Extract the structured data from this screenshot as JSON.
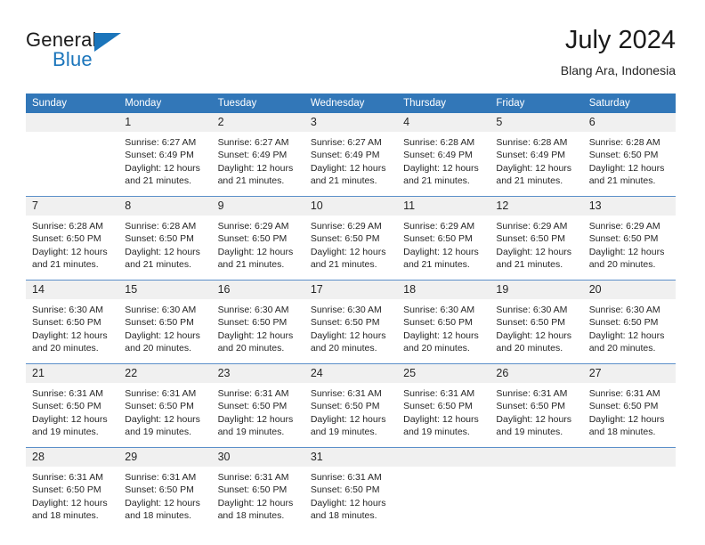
{
  "brand": {
    "name_part1": "General",
    "name_part2": "Blue",
    "logo_icon": "triangle-logo-icon"
  },
  "header": {
    "title": "July 2024",
    "location": "Blang Ara, Indonesia"
  },
  "colors": {
    "header_bar": "#3277b8",
    "brand_blue": "#1b75bb",
    "daynum_band": "#f0f0f0",
    "row_separator": "#5b8fc9",
    "text": "#262626"
  },
  "weekday_headers": [
    "Sunday",
    "Monday",
    "Tuesday",
    "Wednesday",
    "Thursday",
    "Friday",
    "Saturday"
  ],
  "weeks": [
    [
      {
        "day": "",
        "sunrise": "",
        "sunset": "",
        "daylight_line1": "",
        "daylight_line2": ""
      },
      {
        "day": "1",
        "sunrise": "Sunrise: 6:27 AM",
        "sunset": "Sunset: 6:49 PM",
        "daylight_line1": "Daylight: 12 hours",
        "daylight_line2": "and 21 minutes."
      },
      {
        "day": "2",
        "sunrise": "Sunrise: 6:27 AM",
        "sunset": "Sunset: 6:49 PM",
        "daylight_line1": "Daylight: 12 hours",
        "daylight_line2": "and 21 minutes."
      },
      {
        "day": "3",
        "sunrise": "Sunrise: 6:27 AM",
        "sunset": "Sunset: 6:49 PM",
        "daylight_line1": "Daylight: 12 hours",
        "daylight_line2": "and 21 minutes."
      },
      {
        "day": "4",
        "sunrise": "Sunrise: 6:28 AM",
        "sunset": "Sunset: 6:49 PM",
        "daylight_line1": "Daylight: 12 hours",
        "daylight_line2": "and 21 minutes."
      },
      {
        "day": "5",
        "sunrise": "Sunrise: 6:28 AM",
        "sunset": "Sunset: 6:49 PM",
        "daylight_line1": "Daylight: 12 hours",
        "daylight_line2": "and 21 minutes."
      },
      {
        "day": "6",
        "sunrise": "Sunrise: 6:28 AM",
        "sunset": "Sunset: 6:50 PM",
        "daylight_line1": "Daylight: 12 hours",
        "daylight_line2": "and 21 minutes."
      }
    ],
    [
      {
        "day": "7",
        "sunrise": "Sunrise: 6:28 AM",
        "sunset": "Sunset: 6:50 PM",
        "daylight_line1": "Daylight: 12 hours",
        "daylight_line2": "and 21 minutes."
      },
      {
        "day": "8",
        "sunrise": "Sunrise: 6:28 AM",
        "sunset": "Sunset: 6:50 PM",
        "daylight_line1": "Daylight: 12 hours",
        "daylight_line2": "and 21 minutes."
      },
      {
        "day": "9",
        "sunrise": "Sunrise: 6:29 AM",
        "sunset": "Sunset: 6:50 PM",
        "daylight_line1": "Daylight: 12 hours",
        "daylight_line2": "and 21 minutes."
      },
      {
        "day": "10",
        "sunrise": "Sunrise: 6:29 AM",
        "sunset": "Sunset: 6:50 PM",
        "daylight_line1": "Daylight: 12 hours",
        "daylight_line2": "and 21 minutes."
      },
      {
        "day": "11",
        "sunrise": "Sunrise: 6:29 AM",
        "sunset": "Sunset: 6:50 PM",
        "daylight_line1": "Daylight: 12 hours",
        "daylight_line2": "and 21 minutes."
      },
      {
        "day": "12",
        "sunrise": "Sunrise: 6:29 AM",
        "sunset": "Sunset: 6:50 PM",
        "daylight_line1": "Daylight: 12 hours",
        "daylight_line2": "and 21 minutes."
      },
      {
        "day": "13",
        "sunrise": "Sunrise: 6:29 AM",
        "sunset": "Sunset: 6:50 PM",
        "daylight_line1": "Daylight: 12 hours",
        "daylight_line2": "and 20 minutes."
      }
    ],
    [
      {
        "day": "14",
        "sunrise": "Sunrise: 6:30 AM",
        "sunset": "Sunset: 6:50 PM",
        "daylight_line1": "Daylight: 12 hours",
        "daylight_line2": "and 20 minutes."
      },
      {
        "day": "15",
        "sunrise": "Sunrise: 6:30 AM",
        "sunset": "Sunset: 6:50 PM",
        "daylight_line1": "Daylight: 12 hours",
        "daylight_line2": "and 20 minutes."
      },
      {
        "day": "16",
        "sunrise": "Sunrise: 6:30 AM",
        "sunset": "Sunset: 6:50 PM",
        "daylight_line1": "Daylight: 12 hours",
        "daylight_line2": "and 20 minutes."
      },
      {
        "day": "17",
        "sunrise": "Sunrise: 6:30 AM",
        "sunset": "Sunset: 6:50 PM",
        "daylight_line1": "Daylight: 12 hours",
        "daylight_line2": "and 20 minutes."
      },
      {
        "day": "18",
        "sunrise": "Sunrise: 6:30 AM",
        "sunset": "Sunset: 6:50 PM",
        "daylight_line1": "Daylight: 12 hours",
        "daylight_line2": "and 20 minutes."
      },
      {
        "day": "19",
        "sunrise": "Sunrise: 6:30 AM",
        "sunset": "Sunset: 6:50 PM",
        "daylight_line1": "Daylight: 12 hours",
        "daylight_line2": "and 20 minutes."
      },
      {
        "day": "20",
        "sunrise": "Sunrise: 6:30 AM",
        "sunset": "Sunset: 6:50 PM",
        "daylight_line1": "Daylight: 12 hours",
        "daylight_line2": "and 20 minutes."
      }
    ],
    [
      {
        "day": "21",
        "sunrise": "Sunrise: 6:31 AM",
        "sunset": "Sunset: 6:50 PM",
        "daylight_line1": "Daylight: 12 hours",
        "daylight_line2": "and 19 minutes."
      },
      {
        "day": "22",
        "sunrise": "Sunrise: 6:31 AM",
        "sunset": "Sunset: 6:50 PM",
        "daylight_line1": "Daylight: 12 hours",
        "daylight_line2": "and 19 minutes."
      },
      {
        "day": "23",
        "sunrise": "Sunrise: 6:31 AM",
        "sunset": "Sunset: 6:50 PM",
        "daylight_line1": "Daylight: 12 hours",
        "daylight_line2": "and 19 minutes."
      },
      {
        "day": "24",
        "sunrise": "Sunrise: 6:31 AM",
        "sunset": "Sunset: 6:50 PM",
        "daylight_line1": "Daylight: 12 hours",
        "daylight_line2": "and 19 minutes."
      },
      {
        "day": "25",
        "sunrise": "Sunrise: 6:31 AM",
        "sunset": "Sunset: 6:50 PM",
        "daylight_line1": "Daylight: 12 hours",
        "daylight_line2": "and 19 minutes."
      },
      {
        "day": "26",
        "sunrise": "Sunrise: 6:31 AM",
        "sunset": "Sunset: 6:50 PM",
        "daylight_line1": "Daylight: 12 hours",
        "daylight_line2": "and 19 minutes."
      },
      {
        "day": "27",
        "sunrise": "Sunrise: 6:31 AM",
        "sunset": "Sunset: 6:50 PM",
        "daylight_line1": "Daylight: 12 hours",
        "daylight_line2": "and 18 minutes."
      }
    ],
    [
      {
        "day": "28",
        "sunrise": "Sunrise: 6:31 AM",
        "sunset": "Sunset: 6:50 PM",
        "daylight_line1": "Daylight: 12 hours",
        "daylight_line2": "and 18 minutes."
      },
      {
        "day": "29",
        "sunrise": "Sunrise: 6:31 AM",
        "sunset": "Sunset: 6:50 PM",
        "daylight_line1": "Daylight: 12 hours",
        "daylight_line2": "and 18 minutes."
      },
      {
        "day": "30",
        "sunrise": "Sunrise: 6:31 AM",
        "sunset": "Sunset: 6:50 PM",
        "daylight_line1": "Daylight: 12 hours",
        "daylight_line2": "and 18 minutes."
      },
      {
        "day": "31",
        "sunrise": "Sunrise: 6:31 AM",
        "sunset": "Sunset: 6:50 PM",
        "daylight_line1": "Daylight: 12 hours",
        "daylight_line2": "and 18 minutes."
      },
      {
        "day": "",
        "sunrise": "",
        "sunset": "",
        "daylight_line1": "",
        "daylight_line2": ""
      },
      {
        "day": "",
        "sunrise": "",
        "sunset": "",
        "daylight_line1": "",
        "daylight_line2": ""
      },
      {
        "day": "",
        "sunrise": "",
        "sunset": "",
        "daylight_line1": "",
        "daylight_line2": ""
      }
    ]
  ]
}
